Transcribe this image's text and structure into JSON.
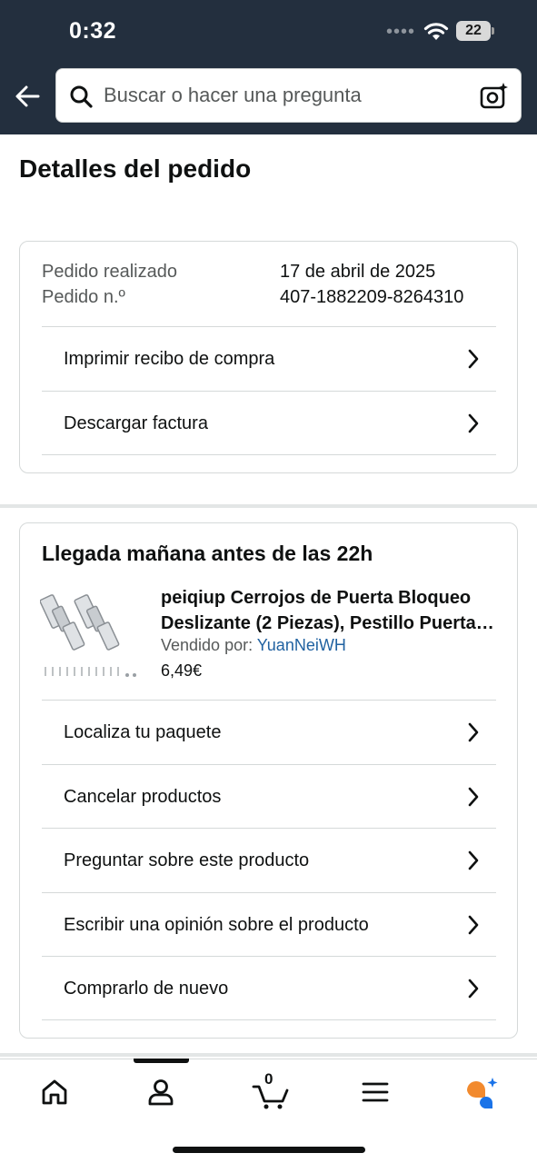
{
  "status_bar": {
    "time": "0:32",
    "signal_dots": "••••",
    "battery_level": "22"
  },
  "search": {
    "placeholder": "Buscar o hacer una pregunta"
  },
  "page": {
    "title": "Detalles del pedido"
  },
  "order_info": {
    "date_label": "Pedido realizado",
    "date_value": "17 de abril de 2025",
    "number_label": "Pedido n.º",
    "number_value": "407-1882209-8264310",
    "links": [
      {
        "label": "Imprimir recibo de compra"
      },
      {
        "label": "Descargar factura"
      }
    ]
  },
  "shipment": {
    "arrival": "Llegada mañana antes de las 22h",
    "product": {
      "title_line1": "peiqiup Cerrojos de Puerta Bloqueo",
      "title_line2": "Deslizante (2 Piezas), Pestillo Puerta de...",
      "seller_label": "Vendido por:",
      "seller_name": "YuanNeiWH",
      "price": "6,49€"
    },
    "actions": [
      {
        "label": "Localiza tu paquete"
      },
      {
        "label": "Cancelar productos"
      },
      {
        "label": "Preguntar sobre este producto"
      },
      {
        "label": "Escribir una opinión sobre el producto"
      },
      {
        "label": "Comprarlo de nuevo"
      }
    ]
  },
  "tab_bar": {
    "cart_count": "0",
    "tabs": [
      {
        "icon": "home-icon"
      },
      {
        "icon": "account-icon"
      },
      {
        "icon": "cart-icon"
      },
      {
        "icon": "menu-icon"
      },
      {
        "icon": "rufus-assistant-icon"
      }
    ],
    "active_tab_index": 1
  },
  "colors": {
    "header_bg": "#232f3e",
    "link": "#2162a1",
    "assistant_orange": "#f28a2e",
    "assistant_blue": "#1a73e8"
  }
}
